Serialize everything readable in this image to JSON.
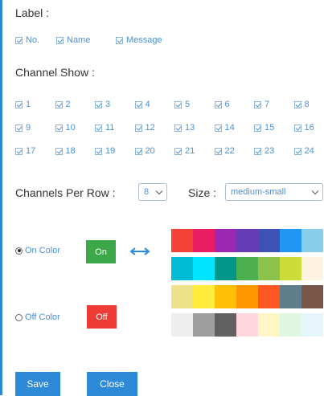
{
  "label_section": {
    "title": "Label :",
    "options": [
      "No.",
      "Name",
      "Message"
    ]
  },
  "channel_show": {
    "title": "Channel Show :",
    "channels": [
      "1",
      "2",
      "3",
      "4",
      "5",
      "6",
      "7",
      "8",
      "9",
      "10",
      "11",
      "12",
      "13",
      "14",
      "15",
      "16",
      "17",
      "18",
      "19",
      "20",
      "21",
      "22",
      "23",
      "24"
    ]
  },
  "channels_per_row": {
    "label": "Channels Per Row :",
    "value": "8"
  },
  "size": {
    "label": "Size :",
    "value": "medium-small"
  },
  "on_color": {
    "label": "On Color",
    "button_label": "On",
    "button_color": "#3da84a",
    "selected": true
  },
  "off_color": {
    "label": "Off Color",
    "button_label": "Off",
    "button_color": "#ee3b36",
    "selected": false
  },
  "swap_icon": "double-arrow-icon",
  "palette": [
    [
      "#f44336",
      "#e91e63",
      "#9c27b0",
      "#673ab7",
      "#3f51b5",
      "#2196f3",
      "#87ceeb"
    ],
    [
      "#00bcd4",
      "#00e5ff",
      "#009688",
      "#4caf50",
      "#8bc34a",
      "#cddc39",
      "#fdf3e0"
    ],
    [
      "#ede28a",
      "#ffeb3b",
      "#ffc107",
      "#ff9800",
      "#ff5722",
      "#607d8b",
      "#795548"
    ],
    [
      "#eeeeee",
      "#9e9e9e",
      "#616161",
      "#ffd6dc",
      "#fff6c7",
      "#dff7e0",
      "#e6f5fb"
    ]
  ],
  "actions": {
    "save": "Save",
    "close": "Close"
  }
}
